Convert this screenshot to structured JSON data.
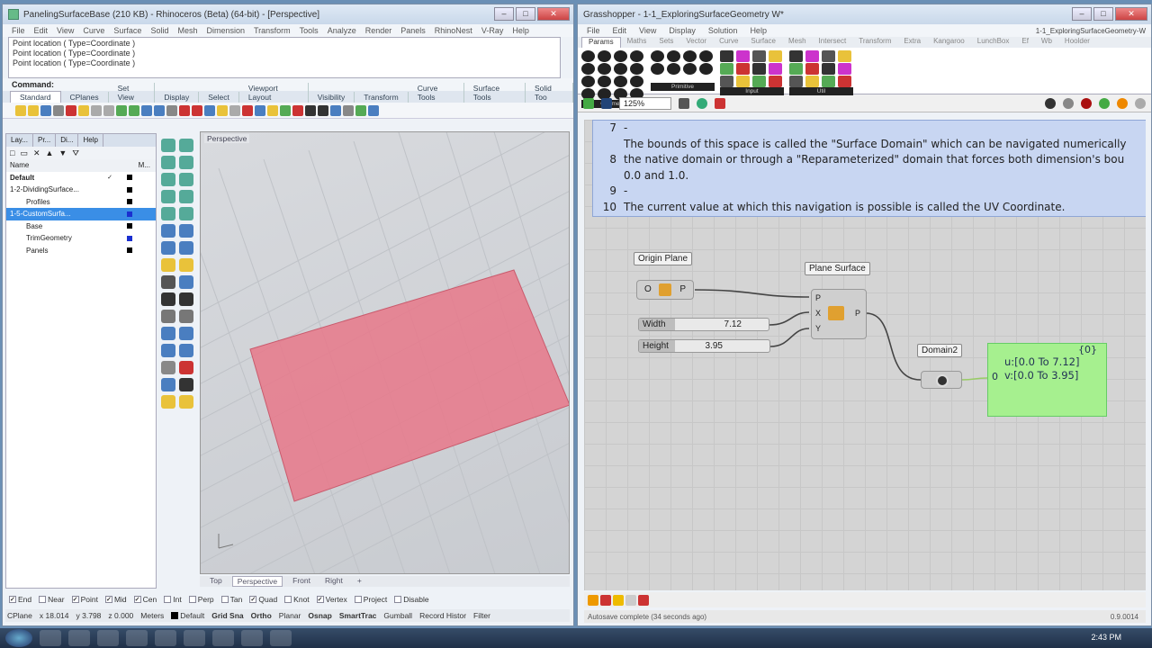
{
  "rhino": {
    "title": "PanelingSurfaceBase (210 KB) - Rhinoceros (Beta) (64-bit) - [Perspective]",
    "menu": [
      "File",
      "Edit",
      "View",
      "Curve",
      "Surface",
      "Solid",
      "Mesh",
      "Dimension",
      "Transform",
      "Tools",
      "Analyze",
      "Render",
      "Panels",
      "RhinoNest",
      "V-Ray",
      "Help"
    ],
    "history": [
      "Point location ( Type=Coordinate )",
      "Point location ( Type=Coordinate )",
      "Point location ( Type=Coordinate )"
    ],
    "command_label": "Command:",
    "toolbar_tabs": [
      "Standard",
      "CPlanes",
      "Set View",
      "Display",
      "Select",
      "Viewport Layout",
      "Visibility",
      "Transform",
      "Curve Tools",
      "Surface Tools",
      "Solid Too"
    ],
    "panel_tabs": [
      "Lay...",
      "Pr...",
      "Di...",
      "Help"
    ],
    "layers_header": {
      "name": "Name",
      "material": "M..."
    },
    "layers": [
      {
        "name": "Default",
        "check": "✓",
        "selected": false,
        "color": "#000000"
      },
      {
        "name": "1-2-DividingSurface...",
        "check": "",
        "selected": false,
        "color": "#000000"
      },
      {
        "name": "Profiles",
        "check": "",
        "selected": false,
        "color": "#000000"
      },
      {
        "name": "1-5-CustomSurfa...",
        "check": "",
        "selected": true,
        "color": "#1a2fd0"
      },
      {
        "name": "Base",
        "check": "",
        "selected": false,
        "color": "#000000"
      },
      {
        "name": "TrimGeometry",
        "check": "",
        "selected": false,
        "color": "#1a2fd0"
      },
      {
        "name": "Panels",
        "check": "",
        "selected": false,
        "color": "#000000"
      }
    ],
    "viewport_label": "Perspective",
    "viewport_tabs": [
      "Top",
      "Perspective",
      "Front",
      "Right"
    ],
    "active_viewport_tab": "Perspective",
    "osnaps": [
      {
        "label": "End",
        "checked": true
      },
      {
        "label": "Near",
        "checked": false
      },
      {
        "label": "Point",
        "checked": true
      },
      {
        "label": "Mid",
        "checked": true
      },
      {
        "label": "Cen",
        "checked": true
      },
      {
        "label": "Int",
        "checked": false
      },
      {
        "label": "Perp",
        "checked": false
      },
      {
        "label": "Tan",
        "checked": false
      },
      {
        "label": "Quad",
        "checked": true
      },
      {
        "label": "Knot",
        "checked": false
      },
      {
        "label": "Vertex",
        "checked": true
      },
      {
        "label": "Project",
        "checked": false
      },
      {
        "label": "Disable",
        "checked": false
      }
    ],
    "status": {
      "cplane": "CPlane",
      "x": "x 18.014",
      "y": "y 3.798",
      "z": "z 0.000",
      "units": "Meters",
      "layer": "Default",
      "toggles": [
        "Grid Sna",
        "Ortho",
        "Planar",
        "Osnap",
        "SmartTrac",
        "Gumball",
        "Record Histor",
        "Filter"
      ]
    },
    "surface_color": "#e8788a"
  },
  "grasshopper": {
    "title": "Grasshopper - 1-1_ExploringSurfaceGeometry W*",
    "menu": [
      "File",
      "Edit",
      "View",
      "Display",
      "Solution",
      "Help"
    ],
    "doc_name": "1-1_ExploringSurfaceGeometry-W",
    "tabs": [
      "Params",
      "Maths",
      "Sets",
      "Vector",
      "Curve",
      "Surface",
      "Mesh",
      "Intersect",
      "Transform",
      "Extra",
      "Kangaroo",
      "LunchBox",
      "Ef",
      "Wb",
      "Hoolder"
    ],
    "ribbon_groups": [
      "Geometry",
      "Primitive",
      "Input",
      "Util"
    ],
    "zoom": "125%",
    "notes": [
      {
        "n": "7",
        "text": "-"
      },
      {
        "n": "",
        "text": "The bounds of this space is called the \"Surface Domain\" which can be navigated numerically"
      },
      {
        "n": "8",
        "text": "the native domain or through a \"Reparameterized\" domain that forces both dimension's bou"
      },
      {
        "n": "",
        "text": "0.0 and 1.0."
      },
      {
        "n": "9",
        "text": "-"
      },
      {
        "n": "10",
        "text": "The current value at which this navigation is possible is called the UV Coordinate."
      }
    ],
    "components": {
      "origin_plane": {
        "label": "Origin Plane",
        "in": "O",
        "out": "P"
      },
      "plane_surface": {
        "label": "Plane Surface",
        "inputs": [
          "P",
          "X",
          "Y"
        ],
        "out": "P"
      },
      "width": {
        "label": "Width",
        "value": "7.12"
      },
      "height": {
        "label": "Height",
        "value": "3.95"
      },
      "domain2": {
        "label": "Domain2"
      },
      "panel": {
        "header": "{0}",
        "index": "0",
        "lines": [
          "u:[0.0 To 7.12]",
          "v:[0.0 To 3.95]"
        ]
      }
    },
    "status": "Autosave complete (34 seconds ago)",
    "version": "0.9.0014"
  },
  "taskbar": {
    "time": "2:43 PM"
  }
}
